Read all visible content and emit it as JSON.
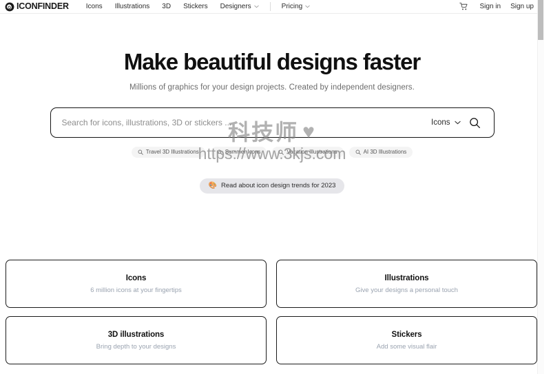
{
  "header": {
    "logo_text": "ICONFINDER",
    "logo_icon": "iconfinder-eye-logo",
    "nav": [
      {
        "label": "Icons",
        "caret": false
      },
      {
        "label": "Illustrations",
        "caret": false
      },
      {
        "label": "3D",
        "caret": false
      },
      {
        "label": "Stickers",
        "caret": false
      },
      {
        "label": "Designers",
        "caret": true
      }
    ],
    "nav_after_divider": [
      {
        "label": "Pricing",
        "caret": true
      }
    ],
    "cart_icon": "shopping-cart-icon",
    "sign_in": "Sign in",
    "sign_up": "Sign up"
  },
  "hero": {
    "headline_part1": "Make ",
    "headline_highlight": "beautiful designs",
    "headline_part2": " faster",
    "highlight_color": "#f7dca8",
    "subheadline": "Millions of graphics for your design projects. Created by independent designers."
  },
  "search": {
    "placeholder": "Search for icons, illustrations, 3D or stickers ...",
    "value": "",
    "type_selected": "Icons",
    "search_icon": "magnifier-icon",
    "chevron_icon": "chevron-down-icon"
  },
  "suggestions": [
    {
      "label": "Travel 3D Illustrations",
      "icon": "search-icon"
    },
    {
      "label": "Summer Icons",
      "icon": "search-icon"
    },
    {
      "label": "Vacation Illustrations",
      "icon": "search-icon"
    },
    {
      "label": "AI 3D Illustrations",
      "icon": "search-icon"
    }
  ],
  "trends_banner": {
    "emoji": "🎨",
    "label": "Read about icon design trends for 2023"
  },
  "cards": [
    {
      "title": "Icons",
      "subtitle": "6 million icons at your fingertips"
    },
    {
      "title": "Illustrations",
      "subtitle": "Give your designs a personal touch"
    },
    {
      "title": "3D illustrations",
      "subtitle": "Bring depth to your designs"
    },
    {
      "title": "Stickers",
      "subtitle": "Add some visual flair"
    }
  ],
  "watermark": {
    "text_cn": "科技师",
    "heart": "♥",
    "url": "https://www.3kjs.com"
  }
}
